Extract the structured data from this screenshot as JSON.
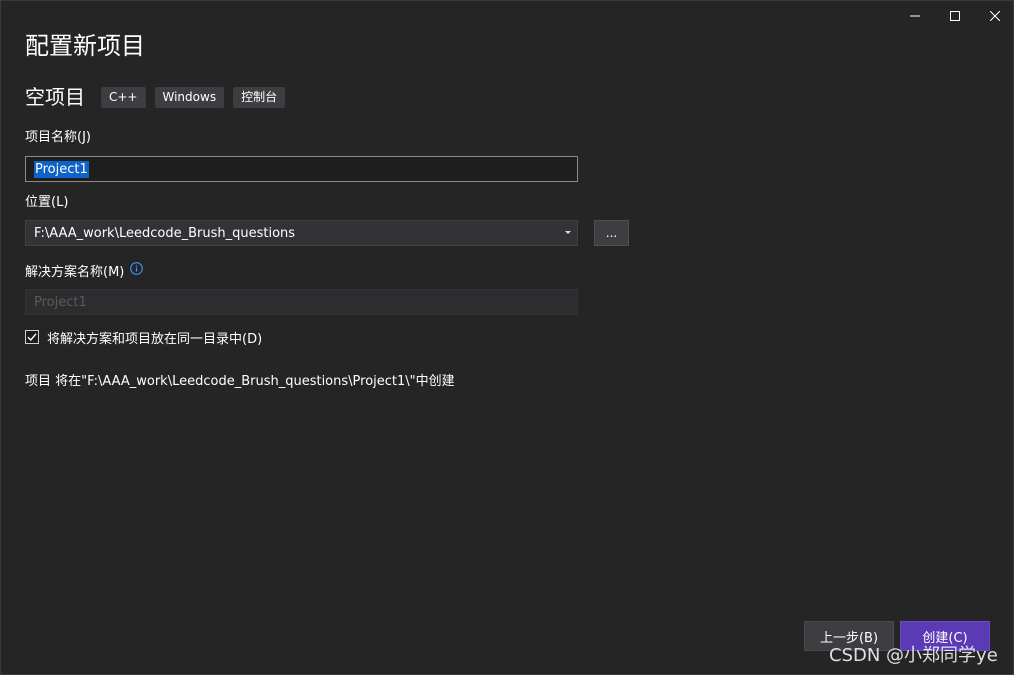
{
  "window": {
    "caption_icons": [
      "minimize-icon",
      "maximize-icon",
      "close-icon"
    ]
  },
  "header": {
    "title": "配置新项目"
  },
  "template": {
    "name": "空项目",
    "tags": [
      "C++",
      "Windows",
      "控制台"
    ]
  },
  "project_name": {
    "label": "项目名称(J)",
    "value": "Project1"
  },
  "location": {
    "label": "位置(L)",
    "value": "F:\\AAA_work\\Leedcode_Brush_questions",
    "browse_label": "..."
  },
  "solution_name": {
    "label": "解决方案名称(M)",
    "placeholder": "Project1",
    "info_icon": "info-icon"
  },
  "same_directory": {
    "label": "将解决方案和项目放在同一目录中(D)",
    "checked": true
  },
  "path_info": "项目 将在\"F:\\AAA_work\\Leedcode_Brush_questions\\Project1\\\"中创建",
  "footer": {
    "back_label": "上一步(B)",
    "create_label": "创建(C)"
  },
  "watermark": "CSDN @小郑同学ye",
  "colors": {
    "background": "#252526",
    "accent": "#5b3bb5",
    "selection": "#0e63c8",
    "info": "#3794ff"
  }
}
